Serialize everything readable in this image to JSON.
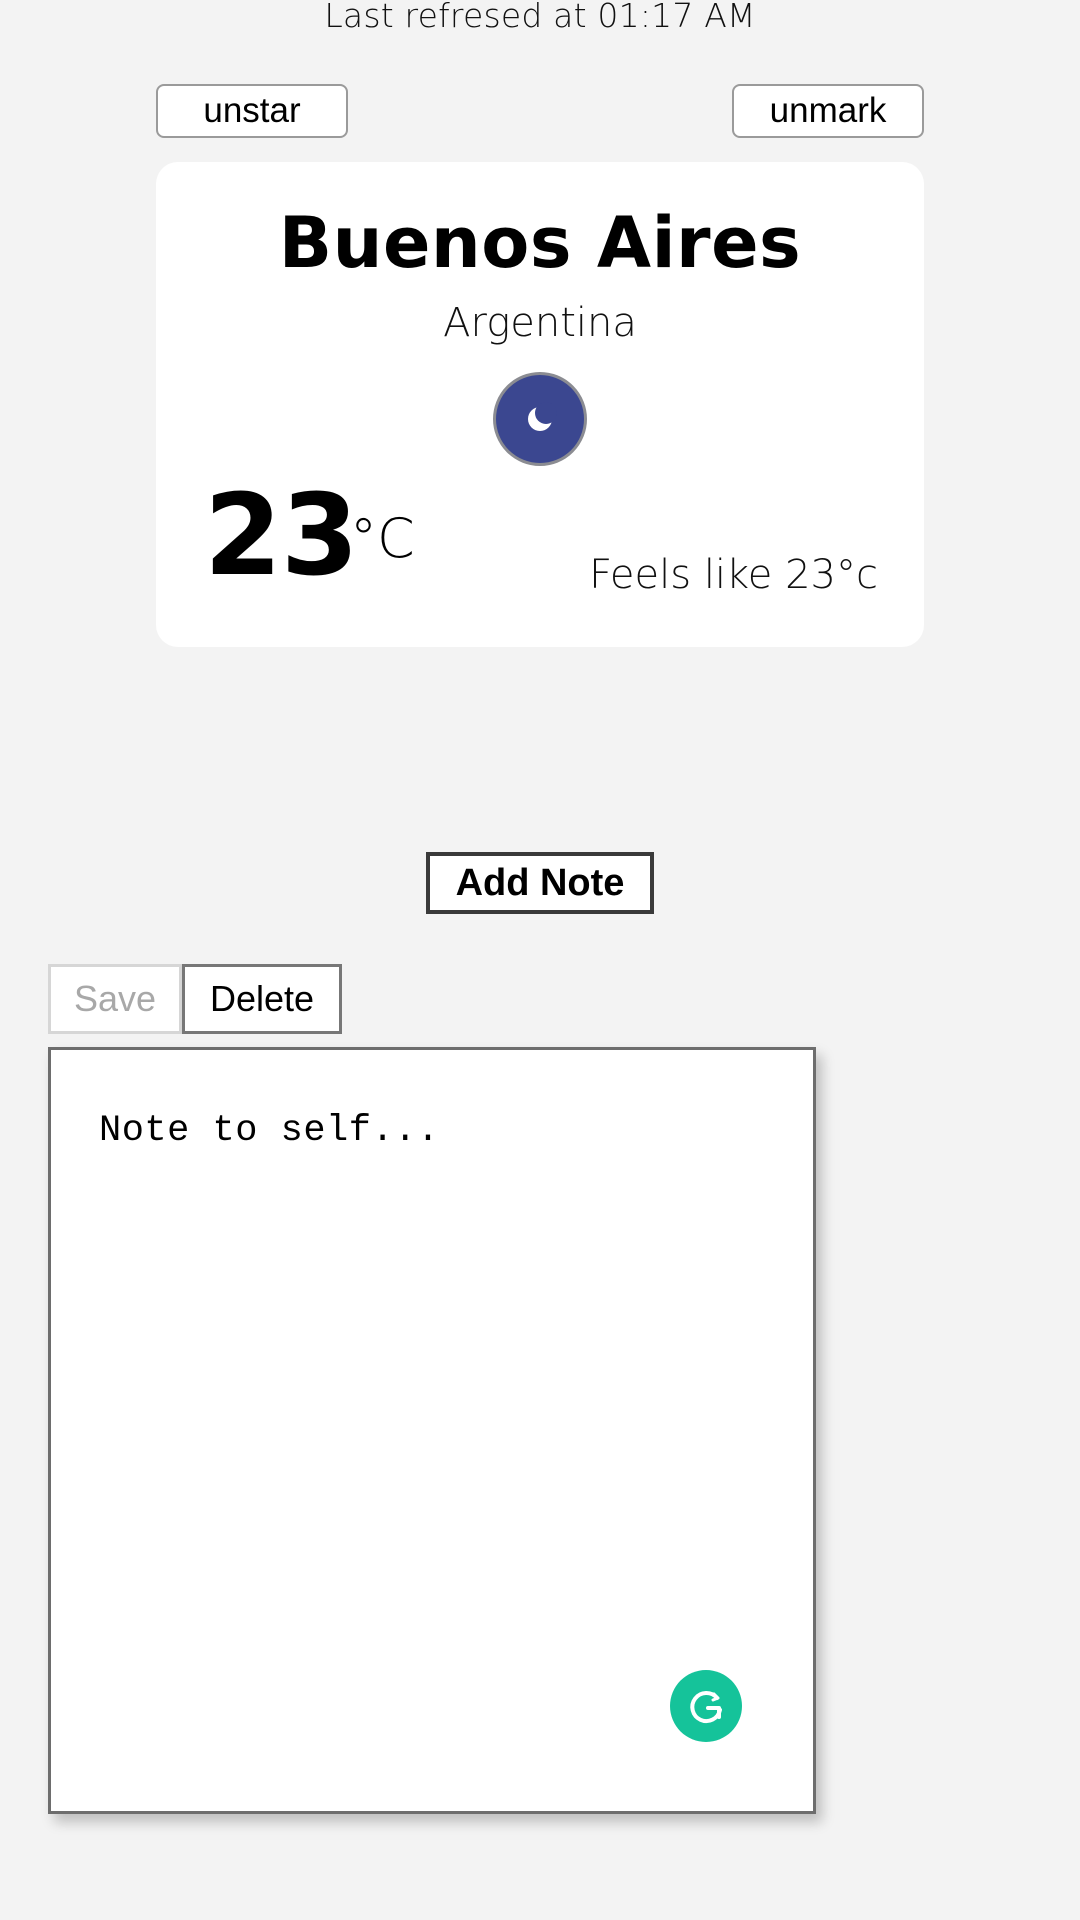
{
  "header": {
    "last_refreshed": "Last refresed at 01:17 AM"
  },
  "actions": {
    "unstar_label": "unstar",
    "unmark_label": "unmark"
  },
  "weather": {
    "city": "Buenos Aires",
    "country": "Argentina",
    "condition_icon": "moon-icon",
    "temperature": "23",
    "unit": "°C",
    "feels_like": "Feels like 23°c"
  },
  "notes": {
    "add_label": "Add Note",
    "save_label": "Save",
    "delete_label": "Delete",
    "note_text": "Note to self...",
    "assistant_icon": "grammarly-icon"
  },
  "colors": {
    "background": "#f3f3f3",
    "weather_icon_bg": "#3b4790",
    "grammarly_green": "#15c39a"
  }
}
